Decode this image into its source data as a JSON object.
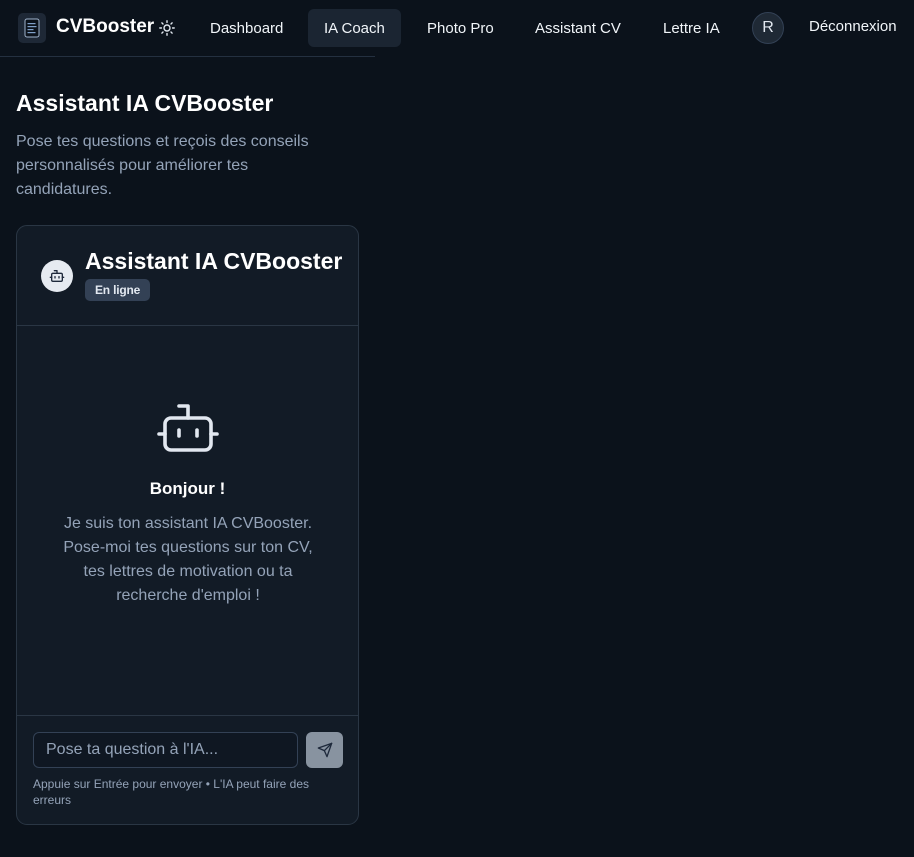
{
  "header": {
    "brand": "CVBooster",
    "nav": [
      {
        "label": "Dashboard"
      },
      {
        "label": "IA Coach"
      },
      {
        "label": "Photo Pro"
      },
      {
        "label": "Assistant CV"
      },
      {
        "label": "Lettre IA"
      }
    ],
    "active_nav": "IA Coach",
    "avatar_initial": "R",
    "logout_label": "Déconnexion"
  },
  "page": {
    "title": "Assistant IA CVBooster",
    "subtitle": "Pose tes questions et reçois des conseils personnalisés pour améliorer tes candidatures."
  },
  "chat": {
    "title": "Assistant IA CVBooster",
    "status": "En ligne",
    "greeting": "Bonjour !",
    "welcome": "Je suis ton assistant IA CVBooster. Pose-moi tes questions sur ton CV, tes lettres de motivation ou ta recherche d'emploi !",
    "input_placeholder": "Pose ta question à l'IA...",
    "hint": "Appuie sur Entrée pour envoyer • L'IA peut faire des erreurs"
  },
  "icons": {
    "logo": "document-icon",
    "theme": "sun-icon",
    "bot": "bot-icon",
    "send": "send-icon"
  },
  "colors": {
    "background": "#0b121b",
    "card": "#121b26",
    "active_nav_bg": "#1b2532",
    "muted_text": "#94a3b8"
  }
}
